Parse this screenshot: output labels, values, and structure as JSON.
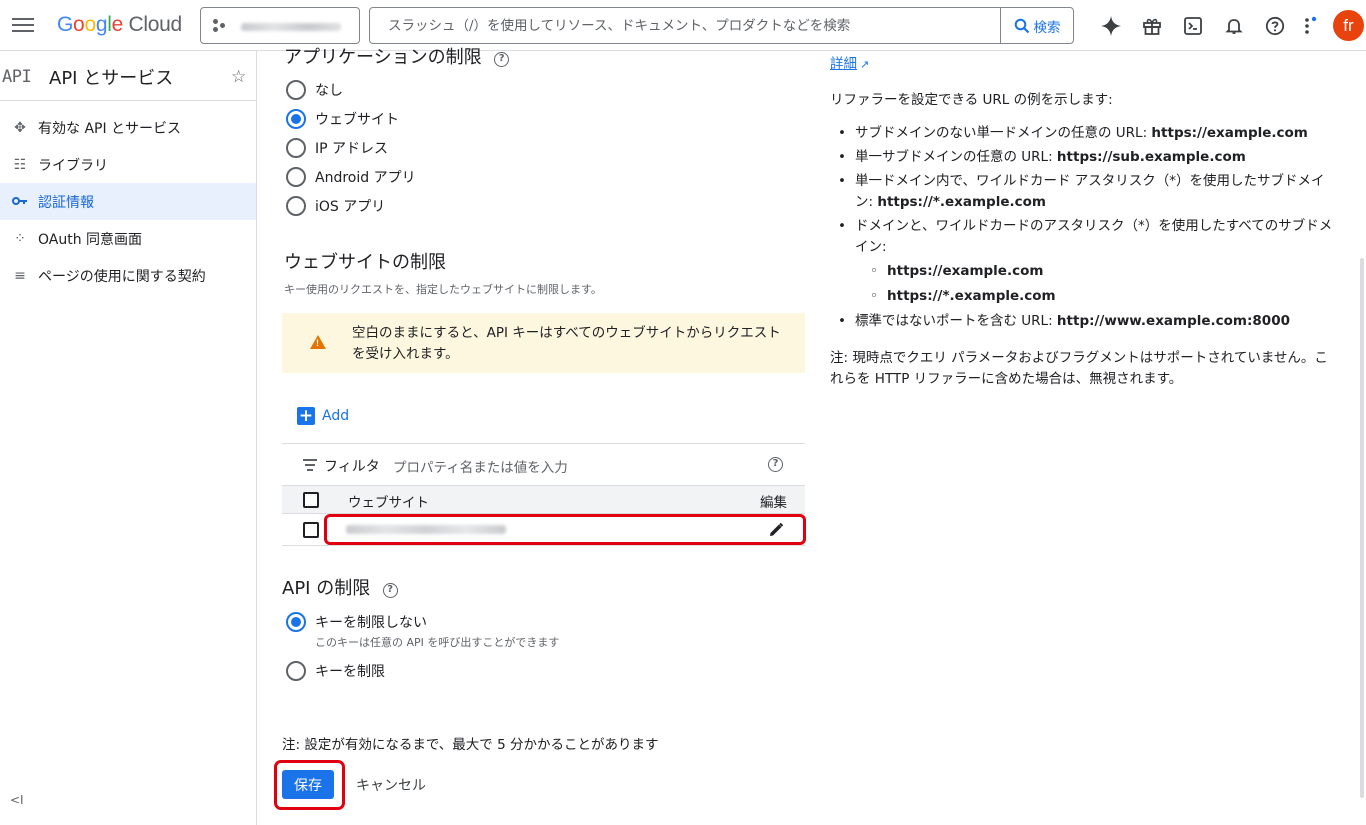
{
  "header": {
    "logo_google": "Google",
    "logo_cloud": "Cloud",
    "search_placeholder": "スラッシュ（/）を使用してリソース、ドキュメント、プロダクトなどを検索",
    "search_button": "検索",
    "avatar_initial": "fr"
  },
  "sidebar": {
    "api_logo": "API",
    "title": "API とサービス",
    "items": [
      {
        "label": "有効な API とサービス",
        "icon": "enabled-apis-icon"
      },
      {
        "label": "ライブラリ",
        "icon": "library-icon"
      },
      {
        "label": "認証情報",
        "icon": "key-icon",
        "active": true
      },
      {
        "label": "OAuth 同意画面",
        "icon": "oauth-icon"
      },
      {
        "label": "ページの使用に関する契約",
        "icon": "agreements-icon"
      }
    ]
  },
  "main": {
    "app_restrictions_title": "アプリケーションの制限",
    "app_restrictions_options": [
      "なし",
      "ウェブサイト",
      "IP アドレス",
      "Android アプリ",
      "iOS アプリ"
    ],
    "app_restrictions_selected": "ウェブサイト",
    "website_title": "ウェブサイトの制限",
    "website_desc": "キー使用のリクエストを、指定したウェブサイトに制限します。",
    "warning_text": "空白のままにすると、API キーはすべてのウェブサイトからリクエストを受け入れます。",
    "add_label": "Add",
    "filter_label": "フィルタ",
    "filter_placeholder": "プロパティ名または値を入力",
    "table_headers": {
      "website": "ウェブサイト",
      "edit": "編集"
    },
    "api_restrictions_title": "API の制限",
    "api_options": [
      {
        "label": "キーを制限しない",
        "sub": "このキーは任意の API を呼び出すことができます"
      },
      {
        "label": "キーを制限",
        "sub": ""
      }
    ],
    "api_selected": "キーを制限しない",
    "note": "注: 設定が有効になるまで、最大で 5 分かかることがあります",
    "save_label": "保存",
    "cancel_label": "キャンセル"
  },
  "right_panel": {
    "detail_link": "詳細",
    "intro": "リファラーを設定できる URL の例を示します:",
    "examples": [
      {
        "text": "サブドメインのない単一ドメインの任意の URL: ",
        "url": "https://example.com"
      },
      {
        "text": "単一サブドメインの任意の URL: ",
        "url": "https://sub.example.com"
      },
      {
        "text": "単一ドメイン内で、ワイルドカード アスタリスク（*）を使用したサブドメイン: ",
        "url": "https://*.example.com"
      },
      {
        "text": "ドメインと、ワイルドカードのアスタリスク（*）を使用したすべてのサブドメイン:",
        "url": ""
      },
      {
        "text": "",
        "url": "https://example.com"
      },
      {
        "text": "",
        "url": "https://*.example.com"
      },
      {
        "text": "標準ではないポートを含む URL: ",
        "url": "http://www.example.com:8000"
      }
    ],
    "footnote": "注: 現時点でクエリ パラメータおよびフラグメントはサポートされていません。これらを HTTP リファラーに含めた場合は、無視されます。"
  },
  "colors": {
    "accent": "#1a73e8",
    "highlight": "#e1000f",
    "warning_bg": "#fef7e0",
    "warning_icon": "#e37400",
    "sidebar_active_bg": "#e8f0fe",
    "avatar_bg": "#e8430d"
  }
}
